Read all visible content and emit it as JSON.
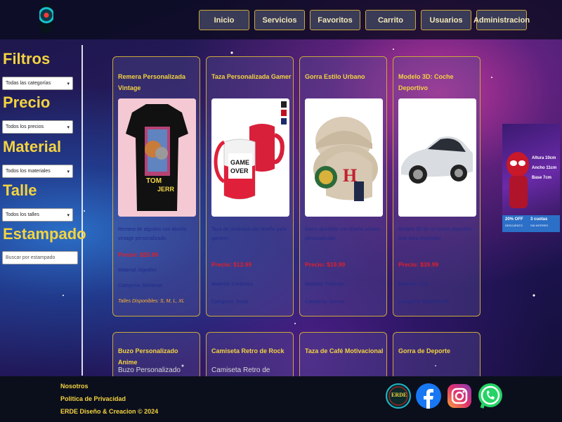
{
  "nav": {
    "items": [
      "Inicio",
      "Servicios",
      "Favoritos",
      "Carrito",
      "Usuarios",
      "Administracion"
    ]
  },
  "sidebar": {
    "filters": [
      {
        "title": "Filtros",
        "type": "select",
        "value": "Todas las categorías"
      },
      {
        "title": "Precio",
        "type": "select",
        "value": "Todos los precios"
      },
      {
        "title": "Material",
        "type": "select",
        "value": "Todos los materiales"
      },
      {
        "title": "Talle",
        "type": "select",
        "value": "Todos los talles"
      },
      {
        "title": "Estampado",
        "type": "input",
        "placeholder": "Buscar por estampado"
      }
    ]
  },
  "products": [
    {
      "title": "Remera Personalizada Vintage",
      "description": "Remera de algodón con diseño vintage personalizado",
      "price": "Precio: $25.99",
      "material": "Material: Algodón",
      "category": "Categoría: Remeras",
      "sizes": "Talles Disponibles: S, M, L, XL",
      "image_icon": "tshirt-image"
    },
    {
      "title": "Taza Personalizada Gamer",
      "description": "Taza de cerámica con diseño para gamers.",
      "price": "Precio: $12.99",
      "material": "Material: Cerámica",
      "category": "Categoría: Tazas",
      "image_icon": "mug-image"
    },
    {
      "title": "Gorra Estilo Urbano",
      "description": "Gorra ajustable con diseño urbano personalizado",
      "price": "Precio: $19.99",
      "material": "Material: Poliéster",
      "category": "Categoría: Gorras",
      "image_icon": "cap-image"
    },
    {
      "title": "Modelo 3D: Coche Deportivo",
      "description": "Modelo 3D de un coche deportivo listo para impresión",
      "price": "Precio: $39.99",
      "material": "Material: PLA",
      "category": "Categoría: Modelos 3D",
      "image_icon": "car-image"
    }
  ],
  "products_row2": [
    {
      "title": "Buzo Personalizado Anime",
      "alt": "Buzo Personalizado"
    },
    {
      "title": "Camiseta Retro de Rock",
      "alt": "Camiseta Retro de"
    },
    {
      "title": "Taza de Café Motivacional",
      "alt": ""
    },
    {
      "title": "Gorra de Deporte",
      "alt": ""
    }
  ],
  "ad": {
    "alto": "Altura 10cm",
    "ancho": "Ancho 11cm",
    "base": "Base 7cm",
    "discount": "20% OFF",
    "discount_sub": "DESCUENTO",
    "installments": "3 cuotas",
    "installments_sub": "SIN INTERES"
  },
  "footer": {
    "links": [
      "Nosotros",
      "Politica de Privacidad",
      "ERDE Diseño & Creacion © 2024"
    ],
    "logo_text": "ERDE",
    "social": [
      "facebook-icon",
      "instagram-icon",
      "whatsapp-icon"
    ]
  },
  "colors": {
    "accent": "#f4d340",
    "price": "#e0202a",
    "card_border": "#c9a83b",
    "nav_bg": "#3a3b57"
  }
}
